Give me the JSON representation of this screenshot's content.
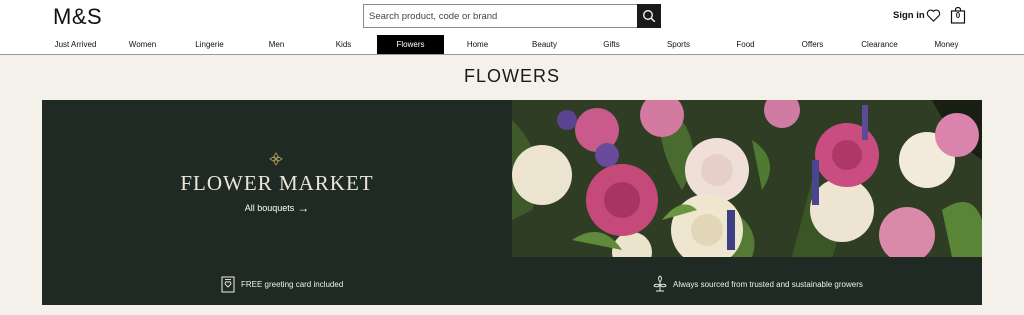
{
  "header": {
    "logo": "M&S",
    "search_placeholder": "Search product, code or brand",
    "sign_in": "Sign in",
    "bag_count": "0"
  },
  "nav": {
    "items": [
      "Just Arrived",
      "Women",
      "Lingerie",
      "Men",
      "Kids",
      "Flowers",
      "Home",
      "Beauty",
      "Gifts",
      "Sports",
      "Food",
      "Offers",
      "Clearance",
      "Money"
    ],
    "active": "Flowers"
  },
  "page": {
    "title": "FLOWERS"
  },
  "banner": {
    "title": "FLOWER MARKET",
    "link": "All bouquets",
    "usps": [
      "FREE greeting card included",
      "Always sourced from trusted and sustainable growers"
    ]
  },
  "colors": {
    "banner_bg": "#1e2a23",
    "page_bg": "#f3f1ea",
    "active_nav": "#000000"
  }
}
